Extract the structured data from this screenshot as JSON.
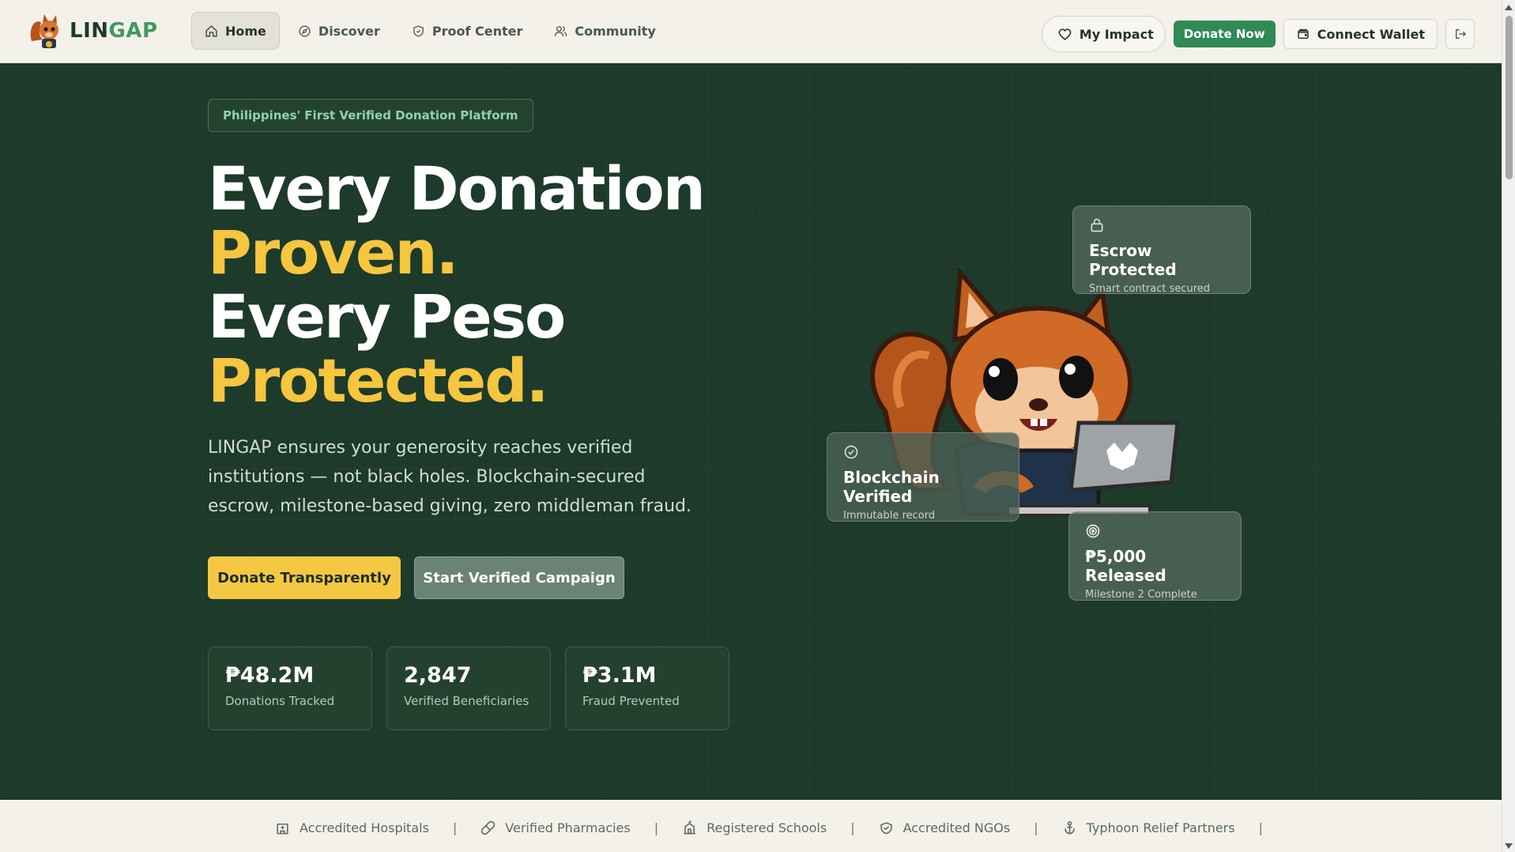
{
  "brand": {
    "name_part1": "LIN",
    "name_part2": "GAP"
  },
  "nav": {
    "links": [
      {
        "label": "Home",
        "icon": "home-icon",
        "active": true
      },
      {
        "label": "Discover",
        "icon": "compass-icon"
      },
      {
        "label": "Proof Center",
        "icon": "shield-icon"
      },
      {
        "label": "Community",
        "icon": "users-icon"
      }
    ],
    "my_impact": "My Impact",
    "donate_now": "Donate Now",
    "connect_wallet": "Connect Wallet"
  },
  "hero": {
    "badge": "Philippines' First Verified Donation Platform",
    "headline_line1": "Every Donation",
    "headline_line2": "Proven.",
    "headline_line3": "Every Peso",
    "headline_line4": "Protected.",
    "lead": "LINGAP ensures your generosity reaches verified institutions — not black holes. Blockchain-secured escrow, milestone-based giving, zero middleman fraud.",
    "cta_primary": "Donate Transparently",
    "cta_secondary": "Start Verified Campaign"
  },
  "stats": [
    {
      "value": "₱48.2M",
      "label": "Donations Tracked"
    },
    {
      "value": "2,847",
      "label": "Verified Beneficiaries"
    },
    {
      "value": "₱3.1M",
      "label": "Fraud Prevented"
    }
  ],
  "cards": {
    "escrow": {
      "title": "Escrow Protected",
      "subtitle": "Smart contract secured",
      "icon": "lock-icon"
    },
    "chain": {
      "title": "Blockchain Verified",
      "subtitle": "Immutable record",
      "icon": "check-circle-icon"
    },
    "release": {
      "title": "₱5,000 Released",
      "subtitle": "Milestone 2 Complete",
      "icon": "target-icon"
    }
  },
  "partners": [
    {
      "label": "Accredited Hospitals",
      "icon": "hospital-icon"
    },
    {
      "label": "Verified Pharmacies",
      "icon": "pill-icon"
    },
    {
      "label": "Registered Schools",
      "icon": "school-icon"
    },
    {
      "label": "Accredited NGOs",
      "icon": "handshake-icon"
    },
    {
      "label": "Typhoon Relief Partners",
      "icon": "anchor-icon"
    }
  ],
  "colors": {
    "hero_bg": "#1d3a2b",
    "accent_yellow": "#f5c63e",
    "brand_green": "#2f8a55"
  }
}
